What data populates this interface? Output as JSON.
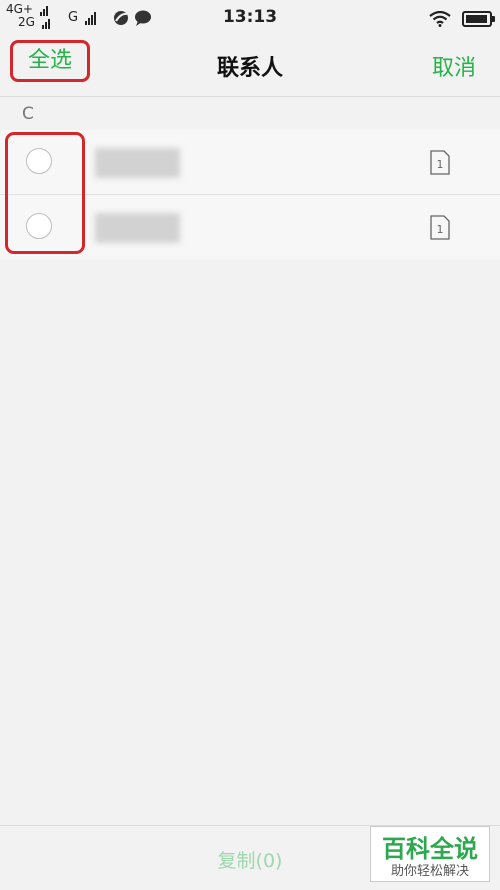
{
  "status_bar": {
    "network_top": "4G+",
    "network_bottom": "2G",
    "network_g": "G",
    "time": "13:13",
    "battery_level": 0.95,
    "icons": [
      "signal-icon",
      "signal-icon",
      "signal-icon",
      "leaf-icon",
      "chat-bubble-icon",
      "wifi-icon",
      "battery-icon"
    ]
  },
  "nav": {
    "select_all": "全选",
    "title": "联系人",
    "cancel": "取消"
  },
  "section": {
    "letter": "C"
  },
  "contacts": [
    {
      "selected": false,
      "icon": "sim-card-icon",
      "sim_number": "1"
    },
    {
      "selected": false,
      "icon": "sim-card-icon",
      "sim_number": "1"
    }
  ],
  "bottom": {
    "copy_label": "复制(0)"
  },
  "watermark": {
    "title": "百科全说",
    "subtitle": "助你轻松解决"
  },
  "colors": {
    "accent_green": "#27b34a",
    "highlight_red": "#d3272c",
    "disabled_green": "#9fd8ad"
  }
}
